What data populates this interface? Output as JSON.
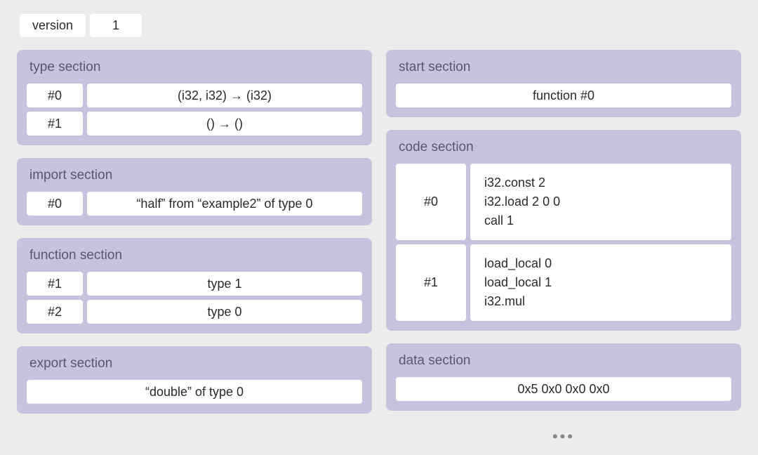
{
  "version": {
    "label": "version",
    "value": "1"
  },
  "type_section": {
    "title": "type section",
    "rows": [
      {
        "index": "#0",
        "value": "(i32, i32) → (i32)"
      },
      {
        "index": "#1",
        "value": "() → ()"
      }
    ]
  },
  "import_section": {
    "title": "import section",
    "rows": [
      {
        "index": "#0",
        "value": "“half” from “example2” of type 0"
      }
    ]
  },
  "function_section": {
    "title": "function section",
    "rows": [
      {
        "index": "#1",
        "value": "type 1"
      },
      {
        "index": "#2",
        "value": "type 0"
      }
    ]
  },
  "export_section": {
    "title": "export section",
    "value": "“double” of type 0"
  },
  "start_section": {
    "title": "start section",
    "value": "function #0"
  },
  "code_section": {
    "title": "code section",
    "rows": [
      {
        "index": "#0",
        "body": "i32.const  2\ni32.load  2  0  0\ncall  1"
      },
      {
        "index": "#1",
        "body": "load_local 0\nload_local 1\ni32.mul"
      }
    ]
  },
  "data_section": {
    "title": "data section",
    "value": "0x5  0x0  0x0  0x0"
  },
  "ellipsis": "•••"
}
